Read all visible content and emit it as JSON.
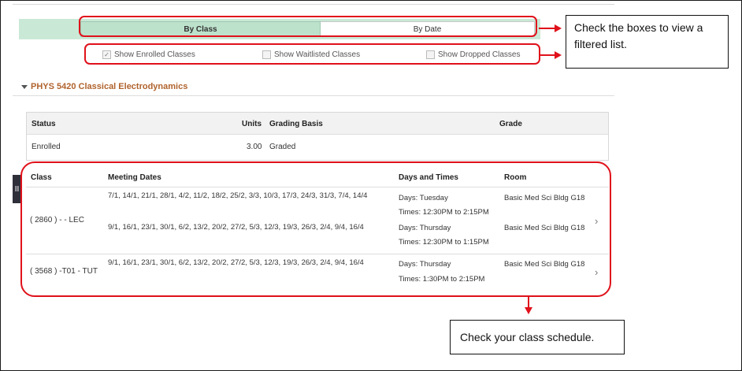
{
  "view_toggle": {
    "by_class": "By Class",
    "by_date": "By Date"
  },
  "filters": [
    {
      "label": "Show Enrolled Classes",
      "checked": true
    },
    {
      "label": "Show Waitlisted Classes",
      "checked": false
    },
    {
      "label": "Show Dropped Classes",
      "checked": false
    }
  ],
  "callouts": {
    "filter_note": "Check the boxes to view a filtered list.",
    "schedule_note": "Check your class schedule."
  },
  "course": {
    "title": "PHYS 5420 Classical Electrodynamics"
  },
  "grade_table": {
    "headers": {
      "status": "Status",
      "units": "Units",
      "grading_basis": "Grading Basis",
      "grade": "Grade"
    },
    "row": {
      "status": "Enrolled",
      "units": "3.00",
      "grading_basis": "Graded",
      "grade": ""
    }
  },
  "side_handle": {
    "label": "II"
  },
  "schedule_table": {
    "headers": {
      "class": "Class",
      "meeting_dates": "Meeting Dates",
      "days_times": "Days and Times",
      "room": "Room"
    },
    "rows": [
      {
        "class": "( 2860 ) - - LEC",
        "meetings": [
          {
            "dates": "7/1, 14/1, 21/1, 28/1, 4/2, 11/2, 18/2, 25/2, 3/3, 10/3, 17/3, 24/3, 31/3, 7/4, 14/4",
            "days": "Days: Tuesday",
            "times": "Times: 12:30PM to 2:15PM",
            "room": "Basic Med Sci Bldg G18"
          },
          {
            "dates": "9/1, 16/1, 23/1, 30/1, 6/2, 13/2, 20/2, 27/2, 5/3, 12/3, 19/3, 26/3, 2/4, 9/4, 16/4",
            "days": "Days: Thursday",
            "times": "Times: 12:30PM to 1:15PM",
            "room": "Basic Med Sci Bldg G18"
          }
        ]
      },
      {
        "class": "( 3568 ) -T01 - TUT",
        "meetings": [
          {
            "dates": "9/1, 16/1, 23/1, 30/1, 6/2, 13/2, 20/2, 27/2, 5/3, 12/3, 19/3, 26/3, 2/4, 9/4, 16/4",
            "days": "Days: Thursday",
            "times": "Times: 1:30PM to 2:15PM",
            "room": "Basic Med Sci Bldg G18"
          }
        ]
      }
    ]
  },
  "icons": {
    "row_chevron": "chevron-right-icon",
    "section_toggle": "triangle-down-icon",
    "checkbox_mark": "checkmark-icon"
  },
  "colors": {
    "annotation_red": "#e0111b",
    "course_title": "#b0632c",
    "toggle_active": "#bde2cc"
  }
}
